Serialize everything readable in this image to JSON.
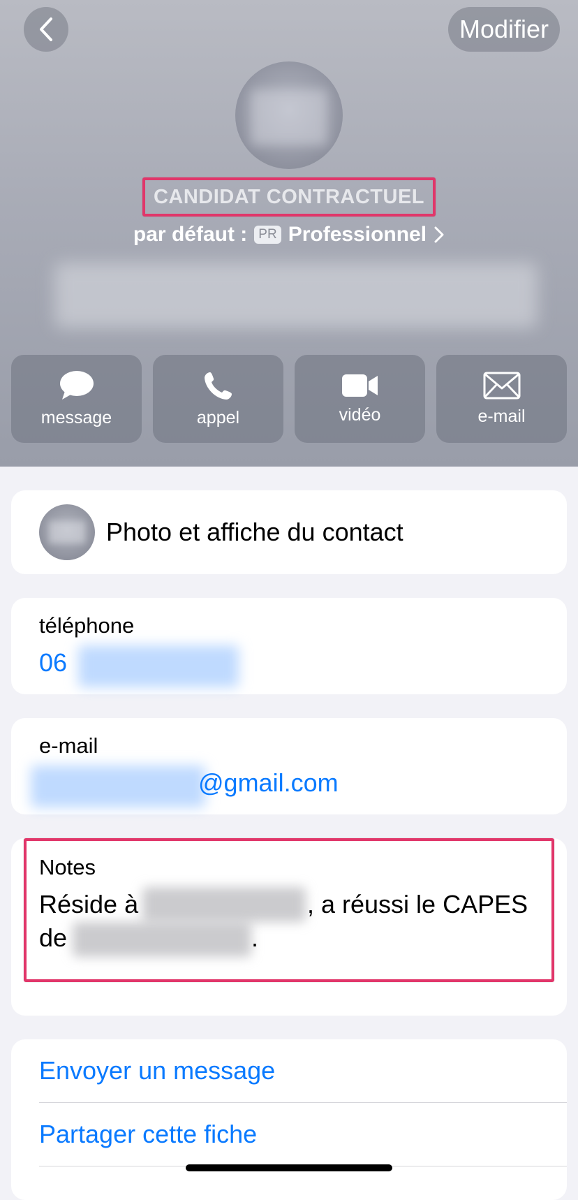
{
  "nav": {
    "back_icon": "chevron-left-icon",
    "edit_label": "Modifier"
  },
  "contact": {
    "company": "CANDIDAT CONTRACTUEL",
    "default_prefix": "par défaut :",
    "default_badge": "PR",
    "default_label": "Professionnel"
  },
  "actions": [
    {
      "label": "message",
      "icon": "message-bubble-icon"
    },
    {
      "label": "appel",
      "icon": "phone-icon"
    },
    {
      "label": "vidéo",
      "icon": "video-camera-icon"
    },
    {
      "label": "e-mail",
      "icon": "envelope-icon"
    }
  ],
  "photo_poster": {
    "label": "Photo et affiche du contact"
  },
  "phone": {
    "label": "téléphone",
    "value_prefix": "06"
  },
  "email": {
    "label": "e-mail",
    "value_suffix": "@gmail.com"
  },
  "notes": {
    "label": "Notes",
    "line1_start": "Réside à",
    "line1_end": ", a réussi le CAPES",
    "line2_start": "de",
    "line2_end": "."
  },
  "links": {
    "send_message": "Envoyer un message",
    "share_contact": "Partager cette fiche"
  },
  "colors": {
    "link_blue": "#0a7aff",
    "highlight": "#e1366a",
    "background": "#f2f2f7"
  }
}
